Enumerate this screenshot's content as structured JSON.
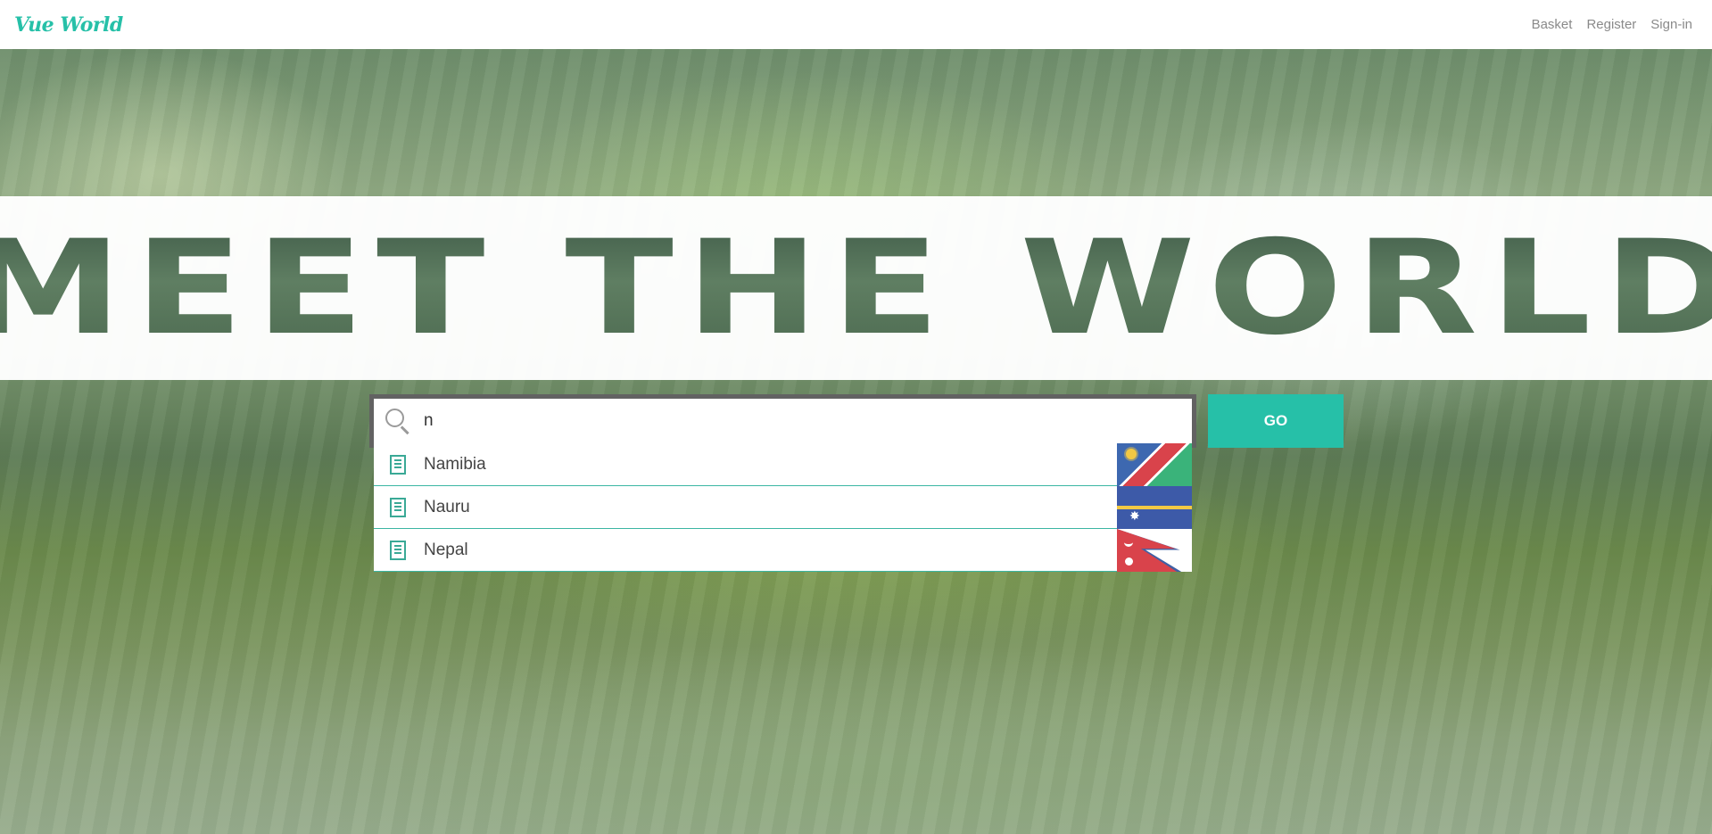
{
  "nav": {
    "logo": "Vue World",
    "links": [
      "Basket",
      "Register",
      "Sign-in"
    ]
  },
  "hero": {
    "title": "MEET THE WORLD"
  },
  "search": {
    "value": "n",
    "button_label": "GO"
  },
  "suggestions": [
    {
      "label": "Namibia",
      "icon": "building-icon",
      "flag": "namibia-flag"
    },
    {
      "label": "Nauru",
      "icon": "building-icon",
      "flag": "nauru-flag"
    },
    {
      "label": "Nepal",
      "icon": "building-icon",
      "flag": "nepal-flag"
    }
  ],
  "colors": {
    "accent": "#26c0a8",
    "nav_text": "#8a8a8a"
  }
}
